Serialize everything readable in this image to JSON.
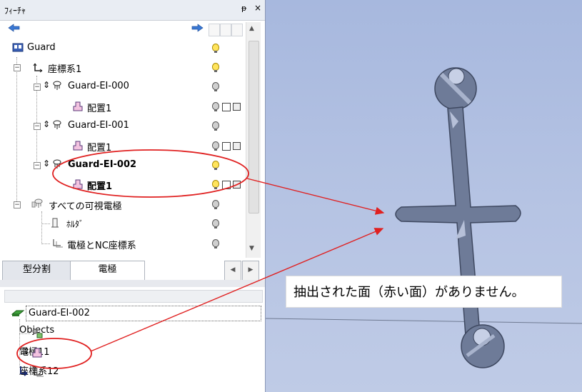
{
  "panel": {
    "title": "ﾌｨｰﾁｬ",
    "pin": "ᵽ",
    "close": "×"
  },
  "tree": {
    "root": "Guard",
    "coord1": "座標系1",
    "ei000": "Guard-EI-000",
    "place000": "配置1",
    "ei001": "Guard-EI-001",
    "place001": "配置1",
    "ei002": "Guard-EI-002",
    "place002": "配置1",
    "visible": "すべての可視電極",
    "holder": "ﾎﾙﾀﾞ",
    "ncframe": "電極とNC座標系"
  },
  "tabs": {
    "mold": "型分割",
    "electrode": "電極"
  },
  "lower": {
    "root": "Guard-EI-002",
    "objects": "Objects",
    "electrode": "電極11",
    "coord": "座標系12"
  },
  "callout": "抽出された面（赤い面）がありません。",
  "colors": {
    "annotation": "#e02020",
    "viewport": "#a7b8de"
  }
}
